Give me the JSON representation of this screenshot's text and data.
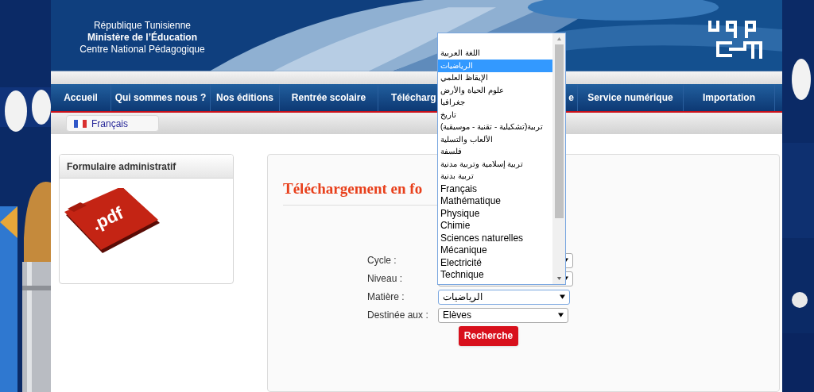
{
  "header": {
    "lines": [
      "République Tunisienne",
      "Ministère de l’Éducation",
      "Centre National Pédagogique"
    ]
  },
  "nav": {
    "items": [
      {
        "label": "Accueil",
        "kind": "full"
      },
      {
        "label": "Qui sommes nous ?",
        "kind": "full"
      },
      {
        "label": "Nos éditions",
        "kind": "full"
      },
      {
        "label": "Rentrée scolaire",
        "kind": "full"
      },
      {
        "label": "Télécharg",
        "kind": "cut_right"
      },
      {
        "label": "e",
        "kind": "cut_left"
      },
      {
        "label": "Service numérique",
        "kind": "full"
      },
      {
        "label": "Importation",
        "kind": "full"
      }
    ]
  },
  "language": {
    "label": "Français"
  },
  "sidebar": {
    "title": "Formulaire administratif",
    "file_label": ".pdf"
  },
  "main": {
    "heading": "Téléchargement en fo",
    "fields": [
      {
        "label": "Cycle :"
      },
      {
        "label": "Niveau :"
      },
      {
        "label": "Matière :",
        "value": "الرياضيات",
        "expanded": true
      },
      {
        "label": "Destinée aux :",
        "value": "Elèves",
        "expanded": false
      }
    ],
    "button": "Recherche"
  },
  "dropdown": {
    "options": [
      {
        "selected": false,
        "kind": "blank"
      },
      {
        "label": "اللغة العربية",
        "selected": false,
        "kind": "arabic"
      },
      {
        "label": "الرياضيات",
        "selected": true,
        "kind": "arabic"
      },
      {
        "label": "الإيقاظ العلمي",
        "selected": false,
        "kind": "arabic"
      },
      {
        "label": "علوم الحياة والأرض",
        "selected": false,
        "kind": "arabic"
      },
      {
        "label": "جغرافيا",
        "selected": false,
        "kind": "arabic"
      },
      {
        "label": "تاريخ",
        "selected": false,
        "kind": "arabic"
      },
      {
        "label": "(تربية(تشكيلية - تقنية - موسيقية",
        "selected": false,
        "kind": "arabic"
      },
      {
        "label": "الألعاب والتسلية",
        "selected": false,
        "kind": "arabic"
      },
      {
        "label": "فلسفة",
        "selected": false,
        "kind": "arabic"
      },
      {
        "label": "تربية إسلامية وتربية مدنية",
        "selected": false,
        "kind": "arabic"
      },
      {
        "label": "تربية بدنية",
        "selected": false,
        "kind": "arabic"
      },
      {
        "label": "Français",
        "selected": false,
        "kind": "latin"
      },
      {
        "label": "Mathématique",
        "selected": false,
        "kind": "latin"
      },
      {
        "label": "Physique",
        "selected": false,
        "kind": "latin"
      },
      {
        "label": "Chimie",
        "selected": false,
        "kind": "latin"
      },
      {
        "label": "Sciences naturelles",
        "selected": false,
        "kind": "latin"
      },
      {
        "label": "Mécanique",
        "selected": false,
        "kind": "latin"
      },
      {
        "label": "Electricité",
        "selected": false,
        "kind": "latin"
      },
      {
        "label": "Technique",
        "selected": false,
        "kind": "latin"
      }
    ]
  }
}
